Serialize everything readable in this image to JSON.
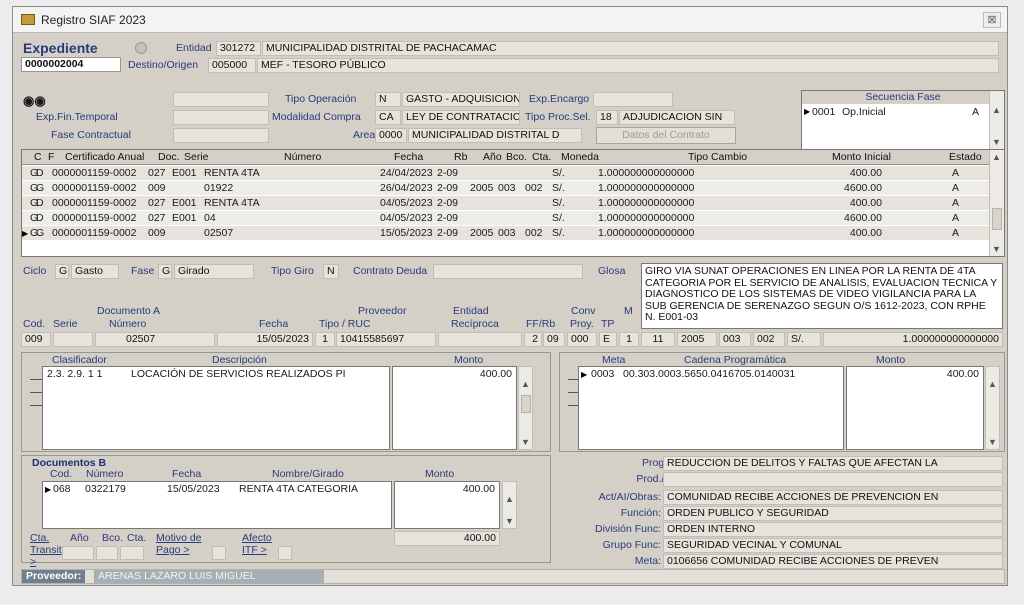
{
  "window": {
    "title": "Registro SIAF 2023",
    "close": "⊠"
  },
  "header": {
    "expediente_label": "Expediente",
    "expediente_number": "0000002004",
    "entidad_label": "Entidad",
    "entidad_code": "301272",
    "entidad_name": "MUNICIPALIDAD DISTRITAL DE PACHACAMAC",
    "destino_label": "Destino/Origen",
    "destino_code": "005000",
    "destino_name": "MEF - TESORO PÚBLICO"
  },
  "info": {
    "tipo_operacion_label": "Tipo Operación",
    "tipo_operacion_code": "N",
    "tipo_operacion_value": "GASTO - ADQUISICION",
    "exp_encargo_label": "Exp.Encargo",
    "exp_fin_temporal_label": "Exp.Fin.Temporal",
    "modalidad_label": "Modalidad Compra",
    "modalidad_code": "CA",
    "modalidad_value": "LEY DE CONTRATACIC",
    "tipo_proc_label": "Tipo Proc.Sel.",
    "tipo_proc_code": "18",
    "tipo_proc_value": "ADJUDICACION SIN",
    "fase_contractual_label": "Fase Contractual",
    "area_label": "Area",
    "area_code": "0000",
    "area_value": "MUNICIPALIDAD DISTRITAL D",
    "datos_contrato_button": "Datos del Contrato"
  },
  "secuencia": {
    "title": "Secuencia Fase",
    "rows": [
      {
        "code": "0001",
        "fase": "Op.Inicial",
        "estado": "A"
      }
    ]
  },
  "main_table": {
    "headers": [
      "C",
      "F",
      "Certificado Anual",
      "Doc.",
      "Serie",
      "Número",
      "Fecha",
      "Rb",
      "Año",
      "Bco.",
      "Cta.",
      "Moneda",
      "Tipo Cambio",
      "Monto Inicial",
      "Estado"
    ],
    "rows": [
      [
        "G",
        "D",
        "0000001159-0002",
        "027",
        "E001",
        "RENTA 4TA",
        "24/04/2023",
        "2-09",
        "",
        "",
        "",
        "S/.",
        "1.000000000000000",
        "400.00",
        "A"
      ],
      [
        "G",
        "G",
        "0000001159-0002",
        "009",
        "",
        "01922",
        "26/04/2023",
        "2-09",
        "2005",
        "003",
        "002",
        "S/.",
        "1.000000000000000",
        "4600.00",
        "A"
      ],
      [
        "G",
        "D",
        "0000001159-0002",
        "027",
        "E001",
        "RENTA 4TA",
        "04/05/2023",
        "2-09",
        "",
        "",
        "",
        "S/.",
        "1.000000000000000",
        "400.00",
        "A"
      ],
      [
        "G",
        "D",
        "0000001159-0002",
        "027",
        "E001",
        "04",
        "04/05/2023",
        "2-09",
        "",
        "",
        "",
        "S/.",
        "1.000000000000000",
        "4600.00",
        "A"
      ],
      [
        "G",
        "G",
        "0000001159-0002",
        "009",
        "",
        "02507",
        "15/05/2023",
        "2-09",
        "2005",
        "003",
        "002",
        "S/.",
        "1.000000000000000",
        "400.00",
        "A"
      ]
    ],
    "selected_row": 4
  },
  "ciclo": {
    "ciclo_label": "Ciclo",
    "ciclo_code": "G",
    "ciclo_value": "Gasto",
    "fase_label": "Fase",
    "fase_code": "G",
    "fase_value": "Girado",
    "tipo_giro_label": "Tipo Giro",
    "tipo_giro_value": "N",
    "contrato_deuda_label": "Contrato Deuda",
    "glosa_label": "Glosa",
    "glosa_text": "GIRO VIA SUNAT OPERACIONES EN LINEA POR LA RENTA DE 4TA CATEGORIA POR EL SERVICIO DE ANALISIS, EVALUACION TECNICA Y DIAGNOSTICO DE LOS SISTEMAS DE VIDEO VIGILANCIA PARA LA SUB GERENCIA DE SERENAZGO SEGUN O/S 1612-2023, CON RPHE N. E001-03"
  },
  "documento_a": {
    "section_label": "Documento A",
    "cod_label": "Cod.",
    "serie_label": "Serie",
    "numero_label": "Número",
    "fecha_label": "Fecha",
    "proveedor_label": "Proveedor",
    "tipo_ruc_label": "Tipo / RUC",
    "entidad_label": "Entidad",
    "reciproca_label": "Recíproca",
    "ffrb_label": "FF/Rb",
    "conv_label": "Conv",
    "proy_label": "Proy.",
    "tp_label": "TP",
    "m_label": "M",
    "cod": "009",
    "numero": "02507",
    "fecha": "15/05/2023",
    "tipo": "1",
    "ruc": "10415585697",
    "ff": "2",
    "rb": "09",
    "proy": "000",
    "tp": "E",
    "extra": [
      "1",
      "11",
      "2005",
      "003",
      "002",
      "S/.",
      "1.000000000000000"
    ]
  },
  "clasificador": {
    "headers": [
      "Clasificador",
      "Descripción",
      "Monto"
    ],
    "rows": [
      [
        "2.3. 2.9. 1 1",
        "LOCACIÓN DE SERVICIOS REALIZADOS PI",
        "400.00"
      ]
    ]
  },
  "meta": {
    "headers": [
      "Meta",
      "Cadena Programática",
      "Monto"
    ],
    "rows": [
      [
        "0003",
        "00.303.0003.5650.0416705.0140031",
        "400.00"
      ]
    ]
  },
  "documentos_b": {
    "title": "Documentos B",
    "headers": [
      "Cod.",
      "Número",
      "Fecha",
      "Nombre/Girado",
      "Monto"
    ],
    "rows": [
      [
        "068",
        "0322179",
        "15/05/2023",
        "RENTA 4TA CATEGORIA",
        "400.00"
      ]
    ],
    "total": "400.00",
    "cta_transit_label": "Cta. Transit >",
    "ano_label": "Año",
    "bco_label": "Bco.",
    "cta_label": "Cta.",
    "motivo_label": "Motivo de Pago >",
    "afecto_label": "Afecto ITF >"
  },
  "programa": {
    "programa_label": "Programa:",
    "programa_value": "REDUCCION DE DELITOS Y FALTAS QUE AFECTAN LA",
    "prod_label": "Prod./Proy.:",
    "prod_value": "",
    "act_label": "Act/AI/Obras:",
    "act_value": "COMUNIDAD RECIBE ACCIONES DE PREVENCION EN",
    "funcion_label": "Función:",
    "funcion_value": "ORDEN PUBLICO Y SEGURIDAD",
    "division_label": "División Func:",
    "division_value": "ORDEN INTERNO",
    "grupo_label": "Grupo Func:",
    "grupo_value": "SEGURIDAD VECINAL Y COMUNAL",
    "meta_label": "Meta:",
    "meta_value": "0106656  COMUNIDAD RECIBE ACCIONES DE PREVEN"
  },
  "proveedor": {
    "label": "Proveedor:",
    "name": "ARENAS LAZARO LUIS MIGUEL"
  }
}
